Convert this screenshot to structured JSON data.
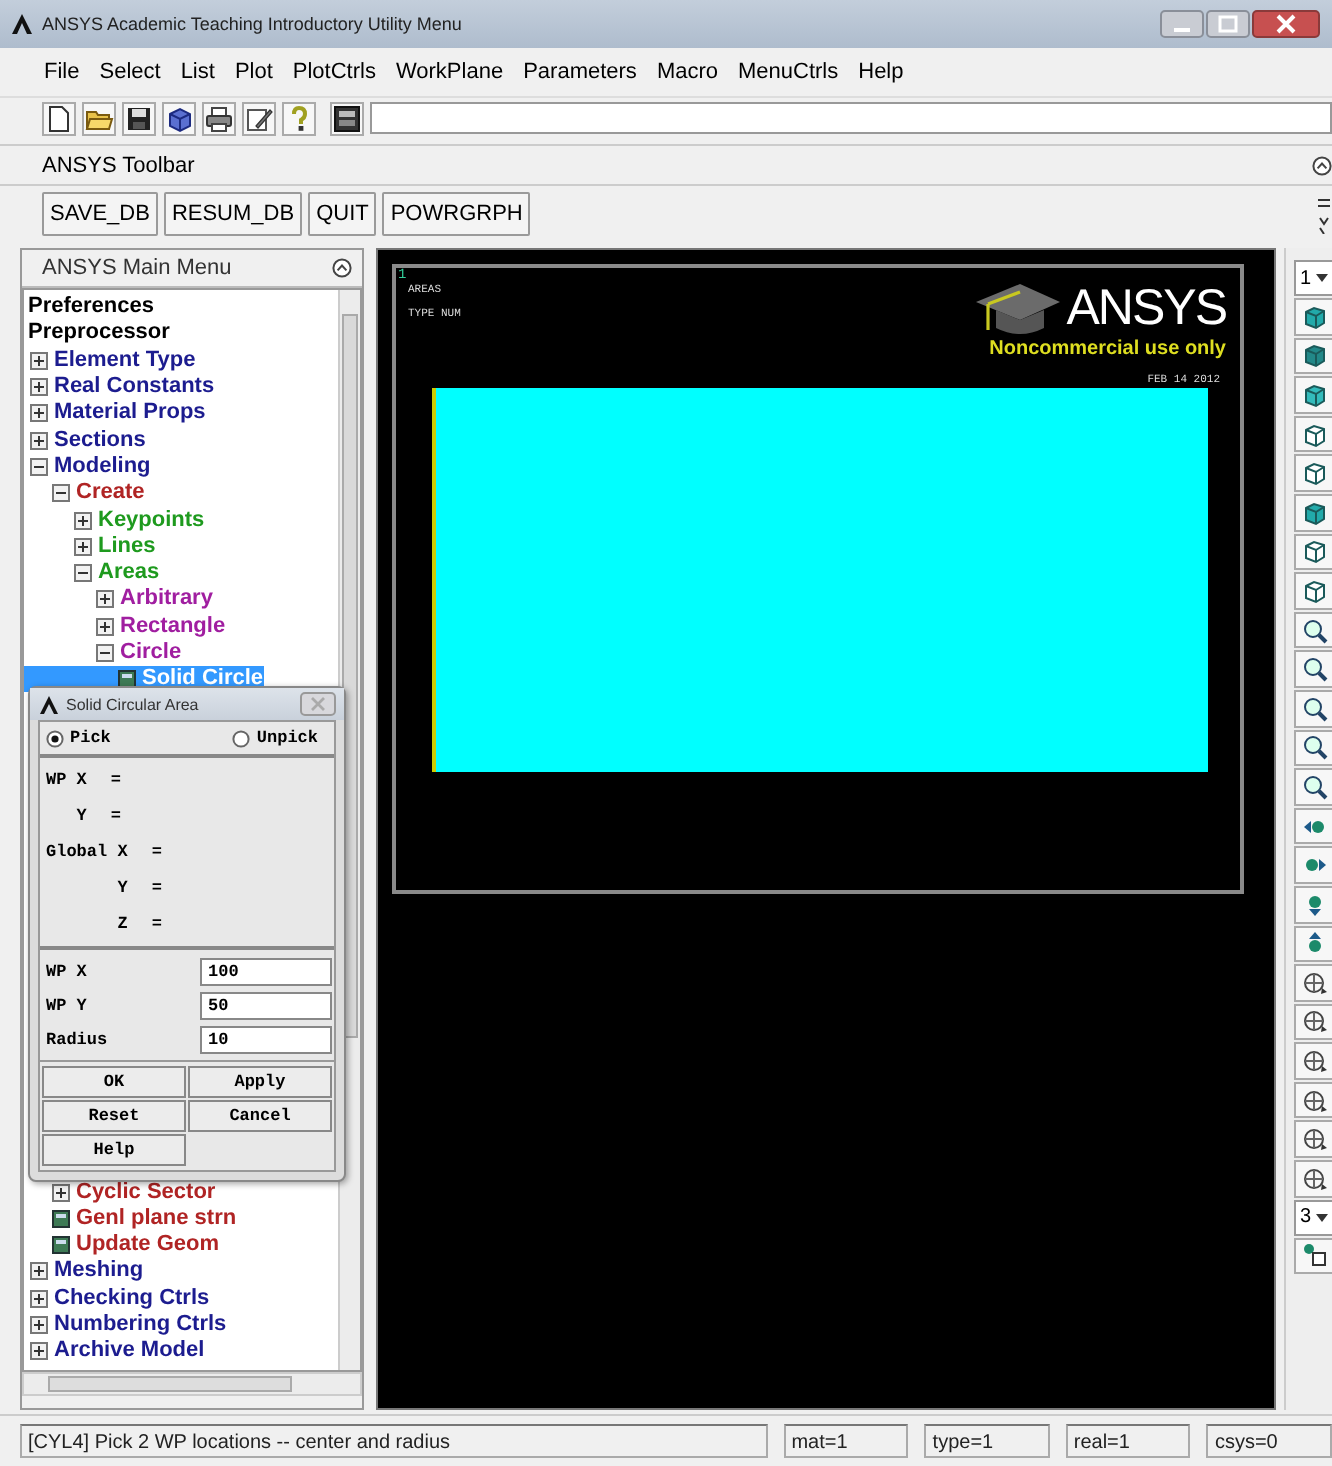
{
  "window": {
    "title": "ANSYS Academic Teaching Introductory Utility Menu"
  },
  "menu": [
    {
      "label": "File"
    },
    {
      "label": "Select"
    },
    {
      "label": "List"
    },
    {
      "label": "Plot"
    },
    {
      "label": "PlotCtrls"
    },
    {
      "label": "WorkPlane"
    },
    {
      "label": "Parameters"
    },
    {
      "label": "Macro"
    },
    {
      "label": "MenuCtrls"
    },
    {
      "label": "Help"
    }
  ],
  "toolbar_icons": [
    {
      "kind": "new"
    },
    {
      "kind": "open"
    },
    {
      "kind": "save"
    },
    {
      "kind": "cube"
    },
    {
      "kind": "print"
    },
    {
      "kind": "report"
    },
    {
      "kind": "help"
    },
    {
      "kind": "command"
    }
  ],
  "toolbar": {
    "title": "ANSYS Toolbar",
    "buttons": [
      "SAVE_DB",
      "RESUM_DB",
      "QUIT",
      "POWRGRPH"
    ]
  },
  "main_menu": {
    "title": "ANSYS Main Menu",
    "items": [
      {
        "label": "Preferences",
        "kind": "heading",
        "selected": false
      },
      {
        "label": "Preprocessor",
        "kind": "heading",
        "selected": false,
        "children": [
          {
            "label": "Element Type",
            "kind": "folder",
            "expanded": false,
            "selected": false
          },
          {
            "label": "Real Constants",
            "kind": "folder",
            "expanded": false,
            "selected": false
          },
          {
            "label": "Material Props",
            "kind": "folder",
            "expanded": false,
            "selected": false
          },
          {
            "label": "Sections",
            "kind": "folder",
            "expanded": false,
            "selected": false
          },
          {
            "label": "Modeling",
            "kind": "folder",
            "expanded": true,
            "selected": false,
            "children": [
              {
                "label": "Create",
                "kind": "folder",
                "expanded": true,
                "selected": false,
                "children": [
                  {
                    "label": "Keypoints",
                    "kind": "folder",
                    "expanded": false,
                    "selected": false
                  },
                  {
                    "label": "Lines",
                    "kind": "folder",
                    "expanded": false,
                    "selected": false
                  },
                  {
                    "label": "Areas",
                    "kind": "folder",
                    "expanded": true,
                    "selected": false,
                    "children": [
                      {
                        "label": "Arbitrary",
                        "kind": "folder",
                        "expanded": false,
                        "selected": false
                      },
                      {
                        "label": "Rectangle",
                        "kind": "folder",
                        "expanded": false,
                        "selected": false
                      },
                      {
                        "label": "Circle",
                        "kind": "folder",
                        "expanded": true,
                        "selected": false,
                        "children": [
                          {
                            "label": "Solid Circle",
                            "kind": "action",
                            "selected": true
                          }
                        ]
                      }
                    ]
                  }
                ]
              },
              {
                "label": "Cyclic Sector",
                "kind": "folder",
                "expanded": false,
                "selected": false
              },
              {
                "label": "Genl plane strn",
                "kind": "action",
                "selected": false
              },
              {
                "label": "Update Geom",
                "kind": "action",
                "selected": false
              }
            ]
          },
          {
            "label": "Meshing",
            "kind": "folder",
            "expanded": false,
            "selected": false
          },
          {
            "label": "Checking Ctrls",
            "kind": "folder",
            "expanded": false,
            "selected": false
          },
          {
            "label": "Numbering Ctrls",
            "kind": "folder",
            "expanded": false,
            "selected": false
          },
          {
            "label": "Archive Model",
            "kind": "folder",
            "expanded": false,
            "selected": false
          }
        ]
      }
    ]
  },
  "dialog": {
    "title": "Solid Circular Area",
    "modes": [
      {
        "label": "Pick",
        "selected": true
      },
      {
        "label": "Unpick",
        "selected": false
      }
    ],
    "readouts": [
      [
        {
          "label": "WP X",
          "sign": "="
        },
        {
          "label": "Y",
          "sign": "="
        }
      ],
      [
        {
          "label": "Global X",
          "sign": "="
        },
        {
          "label": "Y",
          "sign": "="
        },
        {
          "label": "Z",
          "sign": "="
        }
      ]
    ],
    "fields": [
      {
        "label": "WP X",
        "value": "100"
      },
      {
        "label": "WP Y",
        "value": "50"
      },
      {
        "label": "Radius",
        "value": "10"
      }
    ],
    "buttons": [
      "OK",
      "Apply",
      "Reset",
      "Cancel",
      "Help"
    ]
  },
  "graphics": {
    "window_number": "1",
    "lines": [
      "AREAS",
      "TYPE NUM"
    ],
    "logo": "ANSYS",
    "notice": "Noncommercial use only",
    "date": "FEB 14 2012"
  },
  "view_toolbar": [
    {
      "kind": "dropdown",
      "value": "1"
    },
    {
      "kind": "cube"
    },
    {
      "kind": "cube"
    },
    {
      "kind": "cube"
    },
    {
      "kind": "cube"
    },
    {
      "kind": "cube"
    },
    {
      "kind": "cube"
    },
    {
      "kind": "cube"
    },
    {
      "kind": "cube"
    },
    {
      "kind": "zoom"
    },
    {
      "kind": "zoom"
    },
    {
      "kind": "zoom"
    },
    {
      "kind": "zoom"
    },
    {
      "kind": "zoom"
    },
    {
      "kind": "pan"
    },
    {
      "kind": "pan"
    },
    {
      "kind": "pan"
    },
    {
      "kind": "pan"
    },
    {
      "kind": "rotate"
    },
    {
      "kind": "rotate"
    },
    {
      "kind": "rotate"
    },
    {
      "kind": "rotate"
    },
    {
      "kind": "rotate"
    },
    {
      "kind": "rotate"
    },
    {
      "kind": "dropdown",
      "value": "3"
    },
    {
      "kind": "capture"
    }
  ],
  "status_bar": {
    "prompt": "[CYL4]  Pick 2 WP locations -- center and radius",
    "fields": [
      "mat=1",
      "type=1",
      "real=1",
      "csys=0"
    ]
  }
}
